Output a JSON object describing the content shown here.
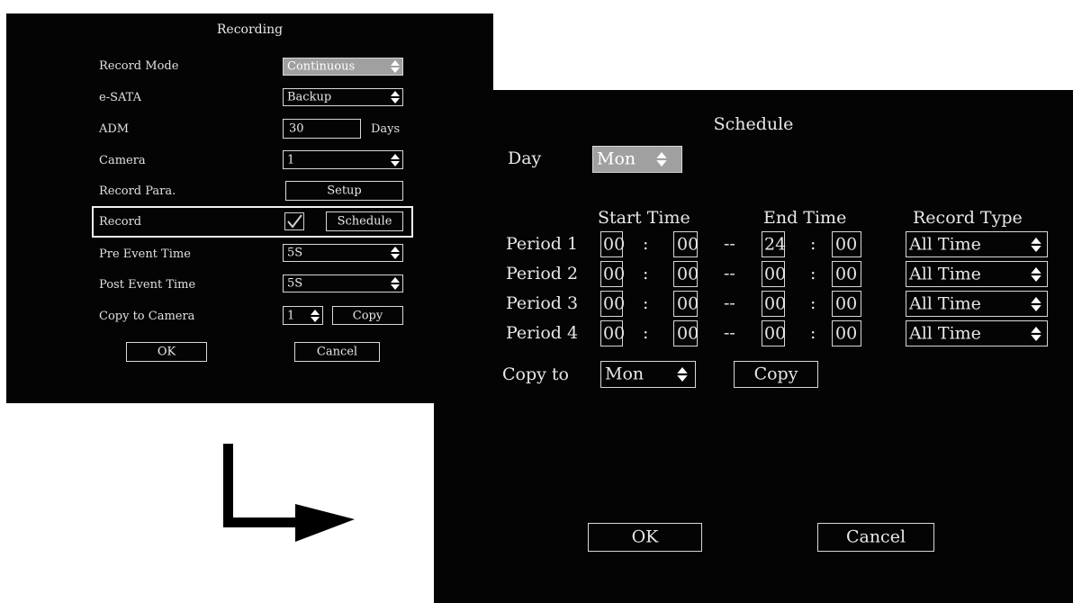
{
  "recording": {
    "title": "Recording",
    "rows": {
      "record_mode": {
        "label": "Record Mode",
        "value": "Continuous"
      },
      "esata": {
        "label": "e-SATA",
        "value": "Backup"
      },
      "adm": {
        "label": "ADM",
        "value": "30",
        "unit": "Days"
      },
      "camera": {
        "label": "Camera",
        "value": "1"
      },
      "record_para": {
        "label": "Record Para.",
        "button": "Setup"
      },
      "record": {
        "label": "Record",
        "checked": true,
        "button": "Schedule"
      },
      "pre_event": {
        "label": "Pre Event Time",
        "value": "5S"
      },
      "post_event": {
        "label": "Post Event Time",
        "value": "5S"
      },
      "copy_to_camera": {
        "label": "Copy to Camera",
        "value": "1",
        "button": "Copy"
      }
    },
    "ok": "OK",
    "cancel": "Cancel"
  },
  "schedule": {
    "title": "Schedule",
    "day_label": "Day",
    "day_value": "Mon",
    "headers": {
      "start": "Start Time",
      "end": "End Time",
      "type": "Record Type"
    },
    "separator": ":",
    "dash": "--",
    "periods": [
      {
        "label": "Period 1",
        "start_h": "00",
        "start_m": "00",
        "end_h": "24",
        "end_m": "00",
        "type": "All Time"
      },
      {
        "label": "Period 2",
        "start_h": "00",
        "start_m": "00",
        "end_h": "00",
        "end_m": "00",
        "type": "All Time"
      },
      {
        "label": "Period 3",
        "start_h": "00",
        "start_m": "00",
        "end_h": "00",
        "end_m": "00",
        "type": "All Time"
      },
      {
        "label": "Period 4",
        "start_h": "00",
        "start_m": "00",
        "end_h": "00",
        "end_m": "00",
        "type": "All Time"
      }
    ],
    "copy_to_label": "Copy to",
    "copy_to_value": "Mon",
    "copy_button": "Copy",
    "ok": "OK",
    "cancel": "Cancel"
  },
  "colors": {
    "panel_bg": "#040404",
    "text": "#e8e8e8",
    "selected_bg": "#a0a0a0",
    "page_bg": "#ffffff"
  },
  "icons": {
    "spinner": "up-down-arrows-icon",
    "checkbox": "checkmark-icon",
    "flow_arrow": "arrow-right-icon"
  }
}
